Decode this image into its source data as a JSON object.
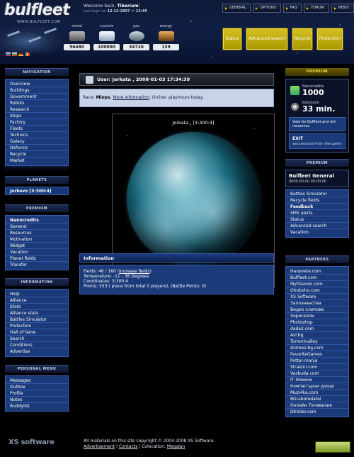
{
  "header": {
    "logo": "bulfleet",
    "logo_url": "WWW.BULFLEET.COM",
    "welcome_prefix": "Welcome back, ",
    "username": "Tiberium",
    "welcome_suffix": "!",
    "last_login_label": "Last login on ",
    "last_login_date": "12-12-2007",
    "last_login_at": " at ",
    "last_login_time": "13:45",
    "nav": [
      "GENERAL",
      "OPTIONS",
      "FAQ",
      "FORUM",
      "NEWS"
    ]
  },
  "resources": [
    {
      "label": "metal",
      "value": "56480",
      "color": "#8a8a8a"
    },
    {
      "label": "crystals",
      "value": "100000",
      "color": "#cfd6e4"
    },
    {
      "label": "gas",
      "value": "34720",
      "color": "#8a9aa8"
    },
    {
      "label": "energy",
      "value": "139",
      "color": "#c08a40"
    }
  ],
  "actions": [
    "Status",
    "Advanced search",
    "Recycle",
    "Protection"
  ],
  "flags": [
    "#d33",
    "#3a3",
    "#fc3",
    "#c33"
  ],
  "navigation": {
    "title": "NAVIGATION",
    "items": [
      "Overview",
      "Buildings",
      "Government",
      "Robots",
      "Research",
      "Ships",
      "Factory",
      "Fleets",
      "Technics",
      "Galaxy",
      "Defence",
      "Recycle",
      "Market"
    ]
  },
  "planets": {
    "title": "PLANETS",
    "items": [
      "Jorkovo [3:300:4]"
    ]
  },
  "premium_left": {
    "title": "PREMIUM",
    "items": [
      "Nanocredits",
      "General",
      "Resources",
      "Motivation",
      "Widget",
      "Vacation",
      "Planet fields",
      "Transfer"
    ]
  },
  "information": {
    "title": "INFORMATION",
    "items": [
      "Help",
      "Alliance",
      "Stats",
      "Alliance stats",
      "Battles Simulator",
      "Protection",
      "Hall of fame",
      "Search",
      "Conditions",
      "Advertise"
    ]
  },
  "personal": {
    "title": "PERSONAL MENU",
    "items": [
      "Messages",
      "Outbox",
      "Profile",
      "Notes",
      "Buddylist"
    ]
  },
  "main": {
    "user_title": "User: Jorkata , 2008-01-03 17:34:39",
    "race_label": "Race: ",
    "race_value": "Miops",
    "race_link": "More information",
    "race_online": "; Online: playhours today.",
    "planet_label": "Jorkata , [3:300:4]",
    "info_title": "Information",
    "fields_prefix": "Fields: 46 / 160 (",
    "fields_link": "Increase fields",
    "fields_suffix": ")",
    "temperature": "Temperature: -11 - 38 Degrees",
    "coordinates": "Coordinates: 3:300:4",
    "points": "Points: 553 ( place from total 0 players), (Battle Points: 0)"
  },
  "premium_right": {
    "title": "PREMIUM",
    "nanocredits_label": "Nanocredits:",
    "nanocredits_value": "1000",
    "botcheck_label": "Botcheck:",
    "botcheck_value": "33 min.",
    "vote_text": "Vote for Bulfleet and win resources",
    "exit_title": "EXIT",
    "exit_sub": "secured exit from the game"
  },
  "premium_general": {
    "title": "PREMIUM",
    "heading": "Bulfleet General",
    "timer": "0000-00-00 00:00:00",
    "items": [
      "Battles Simulator",
      "Recycle fields",
      "Feedback",
      "SMS alerts",
      "Status",
      "Advanced search",
      "Vacation"
    ]
  },
  "partners": {
    "title": "PARTNERS",
    "items": [
      "Hanovete.com",
      "Bulfleet.com",
      "Mythlands.com",
      "Ohoboho.com",
      "XS Software",
      "Запознанства",
      "Видео клипове",
      "Хороскопи",
      "Photoshop",
      "dada2.com",
      "Asl.bg",
      "Torrentvalley",
      "Animes-bg.com",
      "FavoriteGames",
      "Potter-mania",
      "Strastni.com",
      "Vazbuda.com",
      "IT Новини",
      "Компютърни уроци",
      "Muzi4ka.com",
      "BGrabotodatel",
      "Онлайн Телевизия",
      "Dtrailer.com"
    ]
  },
  "footer": {
    "logo": "XS software",
    "copyright": "All materials on this site copyright © 2004-2008 XS Software.",
    "link_ad": "Advertisement",
    "sep": " | ",
    "link_contacts": "Contacts",
    "colo": " | Colocation: ",
    "link_colo": "Megalan"
  }
}
